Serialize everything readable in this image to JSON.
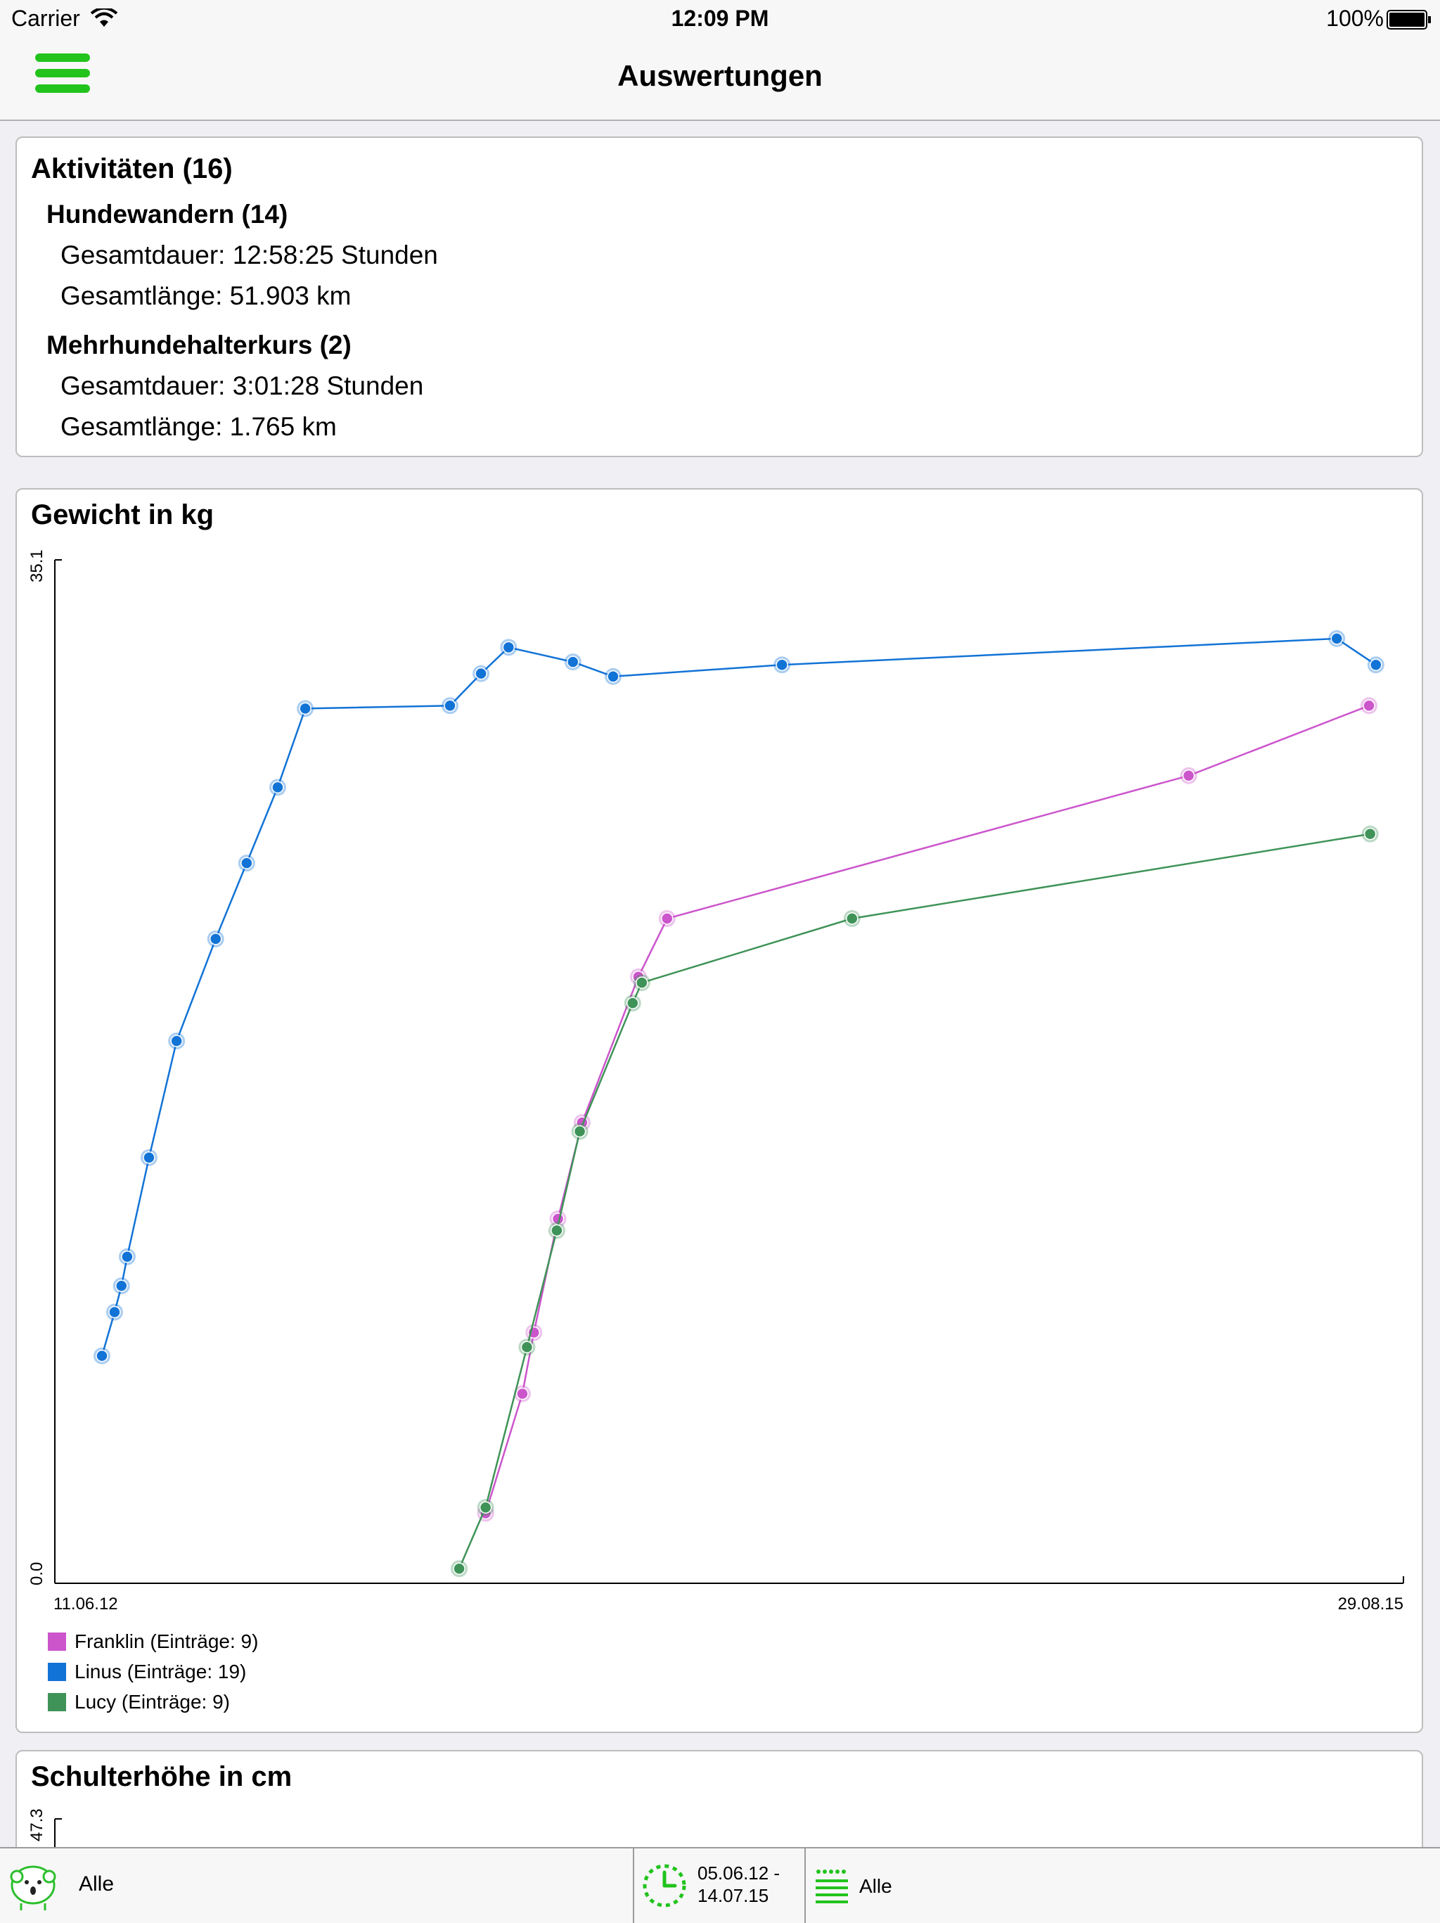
{
  "status_bar": {
    "carrier": "Carrier",
    "time": "12:09 PM",
    "battery": "100%"
  },
  "nav": {
    "title": "Auswertungen",
    "menu_icon": "hamburger-menu-icon",
    "accent_color": "#22c31d"
  },
  "activities": {
    "title": "Aktivitäten (16)",
    "groups": [
      {
        "name": "Hundewandern (14)",
        "duration": "Gesamtdauer: 12:58:25 Stunden",
        "length": "Gesamtlänge: 51.903 km"
      },
      {
        "name": "Mehrhundehalterkurs (2)",
        "duration": "Gesamtdauer: 3:01:28 Stunden",
        "length": "Gesamtlänge: 1.765 km"
      }
    ]
  },
  "weight_card": {
    "title": "Gewicht in kg"
  },
  "height_card": {
    "title": "Schulterhöhe in cm",
    "y_max_label": "47.3"
  },
  "chart_data": {
    "type": "line",
    "title": "Gewicht in kg",
    "xlabel": "",
    "ylabel": "",
    "y_range": [
      0.0,
      35.1
    ],
    "y_tick_labels": [
      "35.1",
      "0.0"
    ],
    "x_range": [
      "2012-06-11",
      "2015-08-29"
    ],
    "x_tick_labels": [
      "11.06.12",
      "29.08.15"
    ],
    "grid": false,
    "legend_position": "bottom-left",
    "series": [
      {
        "name": "Franklin (Einträge: 9)",
        "color": "#cc55cc",
        "points": [
          [
            "2013-06-21",
            2.4
          ],
          [
            "2013-07-23",
            6.5
          ],
          [
            "2013-08-02",
            8.6
          ],
          [
            "2013-08-23",
            12.5
          ],
          [
            "2013-09-13",
            15.8
          ],
          [
            "2013-11-01",
            20.8
          ],
          [
            "2013-11-26",
            22.8
          ],
          [
            "2015-02-23",
            27.7
          ],
          [
            "2015-07-30",
            30.1
          ]
        ]
      },
      {
        "name": "Linus (Einträge: 19)",
        "color": "#1273d6",
        "points": [
          [
            "2012-07-22",
            7.8
          ],
          [
            "2012-08-02",
            9.3
          ],
          [
            "2012-08-08",
            10.2
          ],
          [
            "2012-08-13",
            11.2
          ],
          [
            "2012-09-01",
            14.6
          ],
          [
            "2012-09-25",
            18.6
          ],
          [
            "2012-10-29",
            22.1
          ],
          [
            "2012-11-25",
            24.7
          ],
          [
            "2012-12-22",
            27.3
          ],
          [
            "2013-01-15",
            30.0
          ],
          [
            "2013-05-21",
            30.1
          ],
          [
            "2013-06-17",
            31.2
          ],
          [
            "2013-07-11",
            32.1
          ],
          [
            "2013-09-05",
            31.6
          ],
          [
            "2013-10-10",
            31.1
          ],
          [
            "2014-03-06",
            31.5
          ],
          [
            "2015-07-02",
            32.4
          ],
          [
            "2015-08-05",
            31.5
          ]
        ]
      },
      {
        "name": "Lucy (Einträge: 9)",
        "color": "#3f9358",
        "points": [
          [
            "2013-05-29",
            0.5
          ],
          [
            "2013-06-21",
            2.6
          ],
          [
            "2013-07-27",
            8.1
          ],
          [
            "2013-08-22",
            12.1
          ],
          [
            "2013-09-11",
            15.5
          ],
          [
            "2013-10-27",
            19.9
          ],
          [
            "2013-11-04",
            20.6
          ],
          [
            "2014-05-06",
            22.8
          ],
          [
            "2015-07-31",
            25.7
          ]
        ]
      }
    ]
  },
  "legend": [
    {
      "label": "Franklin (Einträge: 9)",
      "color": "#cc55cc"
    },
    {
      "label": "Linus (Einträge: 19)",
      "color": "#1273d6"
    },
    {
      "label": "Lucy (Einträge: 9)",
      "color": "#3f9358"
    }
  ],
  "bottom_bar": {
    "dog_filter_label": "Alle",
    "dog_icon": "sheep-dog-icon",
    "date_range_line1": "05.06.12 -",
    "date_range_line2": "14.07.15",
    "date_icon": "clock-icon",
    "category_filter_label": "Alle",
    "category_icon": "list-icon"
  }
}
